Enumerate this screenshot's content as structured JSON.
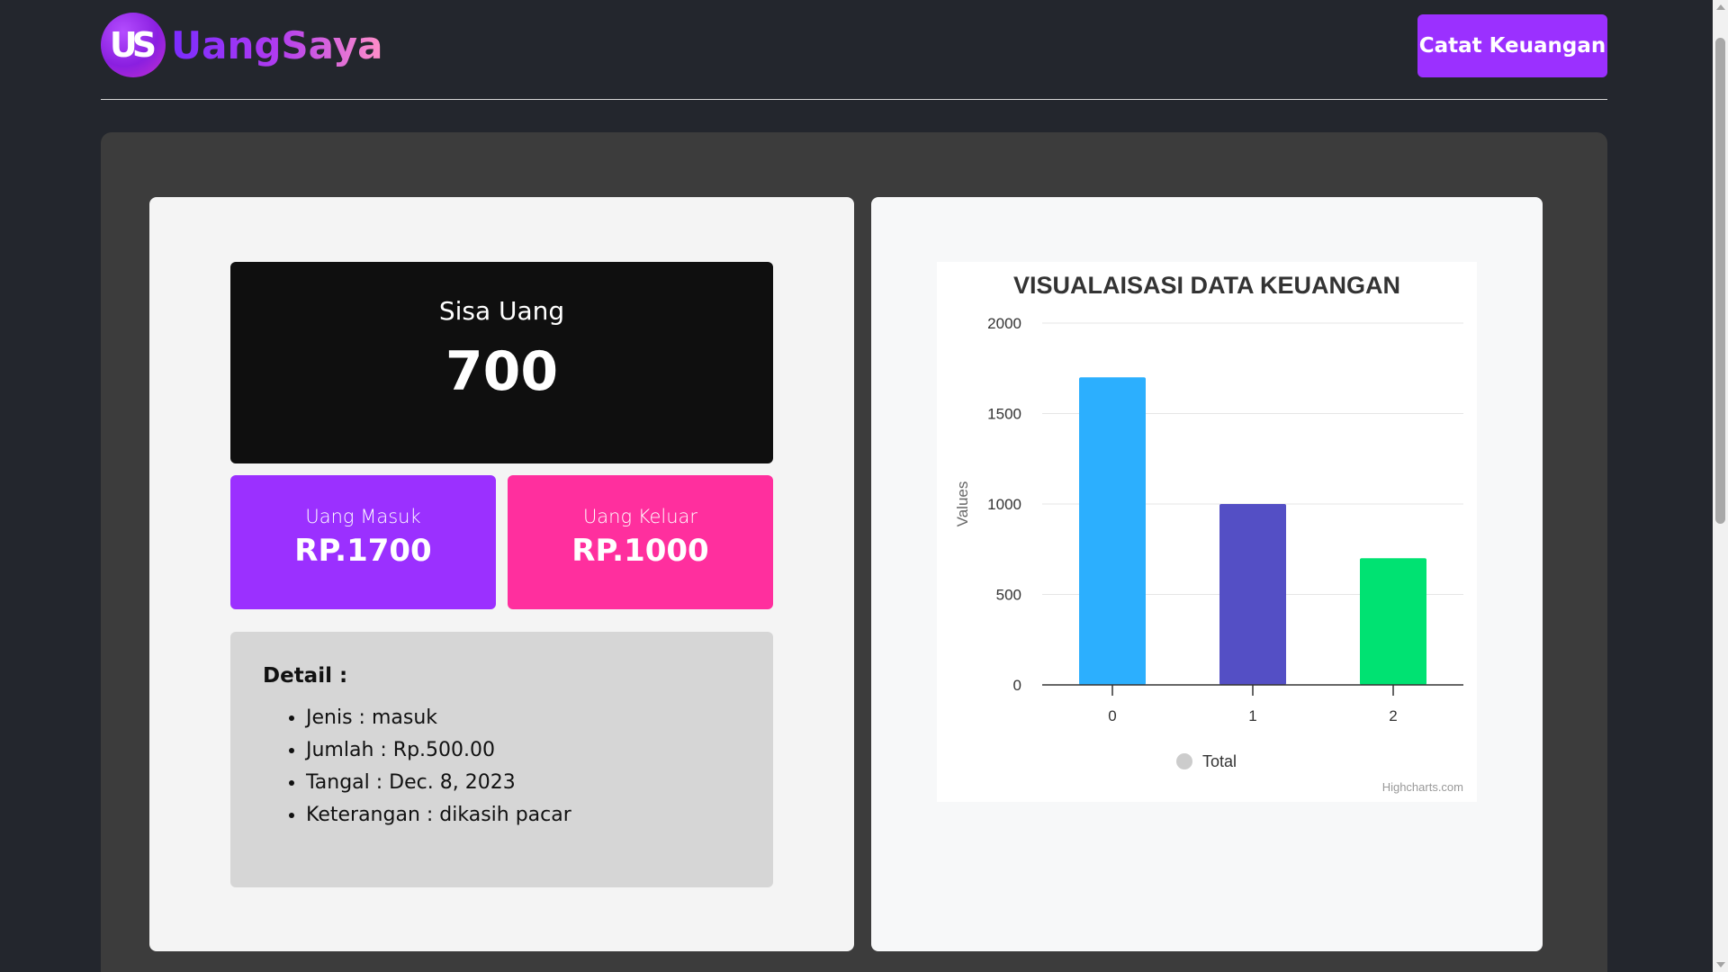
{
  "header": {
    "logo_mark": "US",
    "logo_text": "UangSaya",
    "cta_label": "Catat Keuangan"
  },
  "summary": {
    "balance_label": "Sisa Uang",
    "balance_value": "700",
    "income_label": "Uang Masuk",
    "income_value": "RP.1700",
    "expense_label": "Uang Keluar",
    "expense_value": "RP.1000"
  },
  "detail": {
    "title": "Detail :",
    "items": [
      "Jenis : masuk",
      "Jumlah : Rp.500.00",
      "Tangal : Dec. 8, 2023",
      "Keterangan : dikasih pacar"
    ]
  },
  "chart_data": {
    "type": "bar",
    "title": "VISUALAISASI DATA KEUANGAN",
    "xlabel": "",
    "ylabel": "Values",
    "categories": [
      "0",
      "1",
      "2"
    ],
    "series": [
      {
        "name": "Total",
        "values": [
          1700,
          1000,
          700
        ]
      }
    ],
    "bar_colors": [
      "#2caffe",
      "#544fc5",
      "#00e272"
    ],
    "ylim": [
      0,
      2000
    ],
    "yticks": [
      "0",
      "500",
      "1000",
      "1500",
      "2000"
    ],
    "grid": true,
    "legend": "bottom-center",
    "credits": "Highcharts.com"
  },
  "colors": {
    "accent": "#9b30ff",
    "expense": "#ff2f9e",
    "background": "#23262d"
  }
}
